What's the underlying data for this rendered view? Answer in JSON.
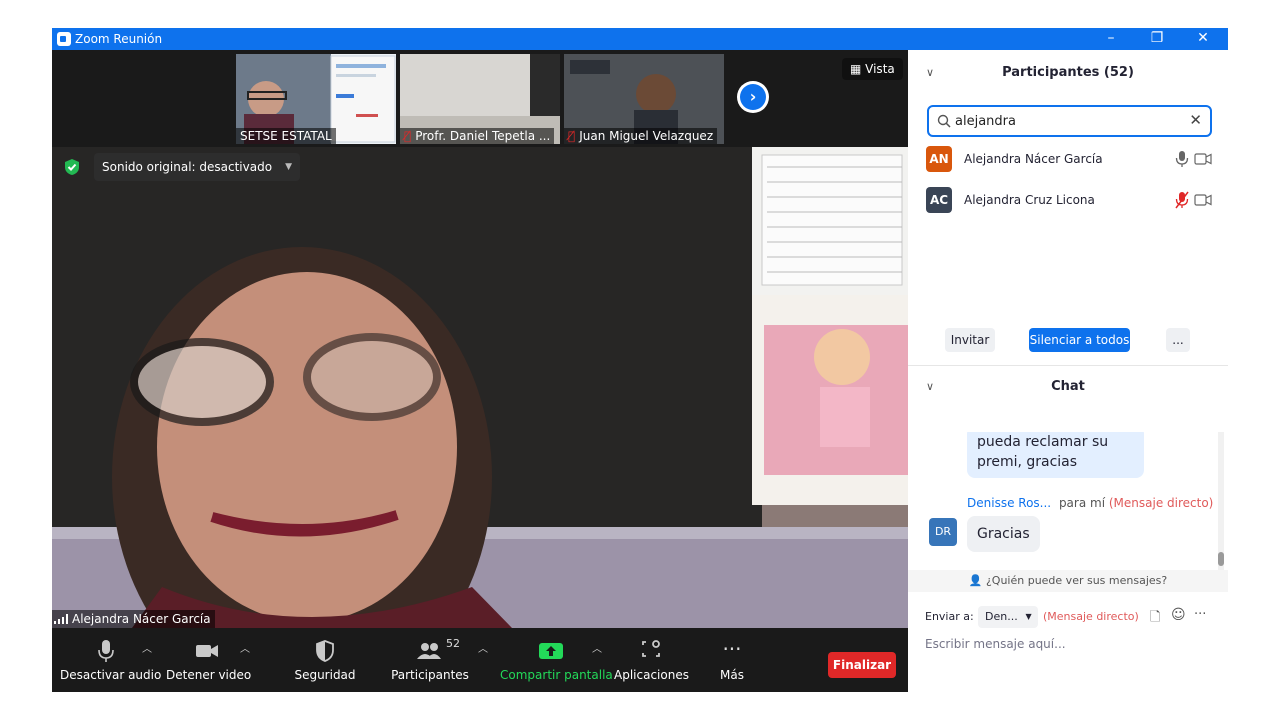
{
  "window": {
    "title": "Zoom Reunión",
    "controls": {
      "minimize": "–",
      "restore": "❐",
      "close": "✕"
    }
  },
  "thumbnails": [
    {
      "name": "SETSE ESTATAL",
      "muted": false
    },
    {
      "name": "Profr. Daniel Tepetla ...",
      "muted": true
    },
    {
      "name": "Juan Miguel Velazquez",
      "muted": true
    }
  ],
  "view_button": {
    "label": "Vista",
    "icon": "grid-icon"
  },
  "main_video": {
    "speaker_name": "Alejandra Nácer García",
    "audio_dropdown": "Sonido original: desactivado"
  },
  "toolbar": {
    "items": [
      {
        "label": "Desactivar audio",
        "icon": "microphone-icon"
      },
      {
        "label": "Detener video",
        "icon": "video-camera-icon"
      },
      {
        "label": "Seguridad",
        "icon": "shield-icon"
      },
      {
        "label": "Participantes",
        "icon": "participants-icon",
        "badge": "52"
      },
      {
        "label": "Compartir pantalla",
        "icon": "share-screen-icon"
      },
      {
        "label": "Aplicaciones",
        "icon": "apps-icon"
      },
      {
        "label": "Más",
        "icon": "more-dots-icon"
      }
    ],
    "end_button": "Finalizar"
  },
  "participants_panel": {
    "title": "Participantes (52)",
    "search_value": "alejandra",
    "participants": [
      {
        "initials": "AN",
        "name": "Alejandra Nácer García",
        "avatar_color": "#d9570c",
        "muted": false
      },
      {
        "initials": "AC",
        "name": "Alejandra Cruz Licona",
        "avatar_color": "#3a4556",
        "muted": true
      }
    ],
    "buttons": {
      "invite": "Invitar",
      "mute_all": "Silenciar a todos",
      "more": "..."
    }
  },
  "chat_panel": {
    "title": "Chat",
    "messages": [
      {
        "text_lines": [
          "pueda reclamar su",
          "premi, gracias"
        ]
      },
      {
        "sender": "Denisse Ros...",
        "to": "para mí",
        "tag": "(Mensaje directo)",
        "initials": "DR",
        "text": "Gracias"
      }
    ],
    "who_can_see": "¿Quién puede ver sus mensajes?",
    "send_to_label": "Enviar a:",
    "send_to_value": "Den...",
    "send_to_tag": "(Mensaje directo)",
    "compose_placeholder": "Escribir mensaje aquí..."
  },
  "colors": {
    "accent": "#0e72ed",
    "end_red": "#e02828",
    "share_green": "#23d959",
    "muted_red": "#e02828",
    "direct_message_red": "#e05a5a"
  }
}
